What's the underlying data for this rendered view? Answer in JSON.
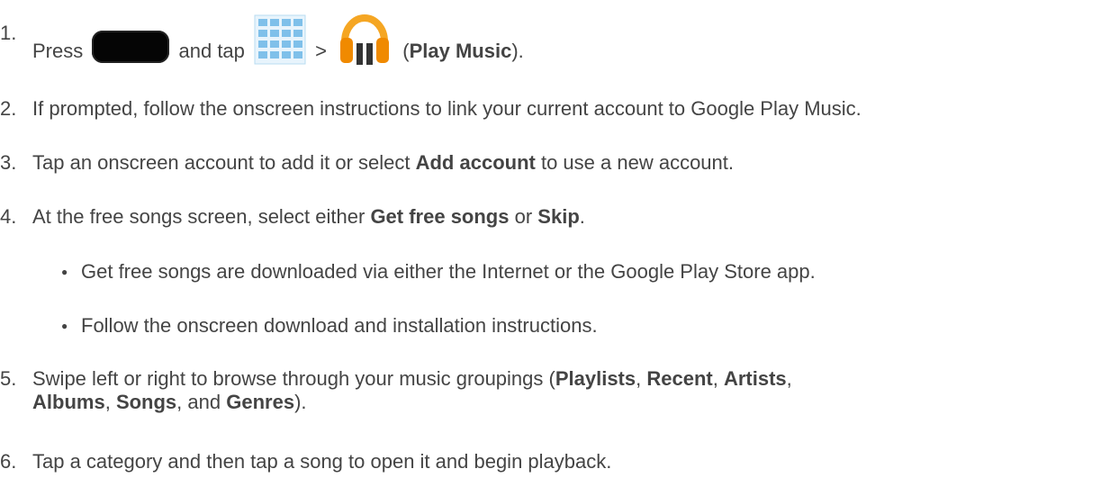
{
  "steps": [
    {
      "number": "1.",
      "parts": {
        "a": "Press",
        "b": "and tap",
        "c": ">",
        "d": "(",
        "e": "Play Music",
        "f": ")."
      }
    },
    {
      "number": "2.",
      "text": "If prompted, follow the onscreen instructions to link your current account to Google Play Music."
    },
    {
      "number": "3.",
      "parts": {
        "a": "Tap an onscreen account to add it or select",
        "b": "Add account",
        "c": "to use a new account."
      }
    },
    {
      "number": "4.",
      "parts": {
        "a": "At the free songs screen, select either",
        "b": "Get free songs",
        "c": "or",
        "d": "Skip",
        "e": "."
      }
    },
    {
      "number": "5.",
      "parts": {
        "a": "Swipe left or right to browse through your music groupings (",
        "b": "Playlists",
        "c": ",",
        "d": "Recent",
        "e": ",",
        "f": "Artists",
        "g": ",",
        "h": "Albums",
        "i": ",",
        "j": "Songs",
        "k": ", and",
        "l": "Genres",
        "m": ")."
      }
    },
    {
      "number": "6.",
      "text": "Tap a category and then tap a song to open it and begin playback."
    }
  ],
  "sub_bullets": [
    {
      "bullet": "●",
      "text": "Get free songs are downloaded via either the Internet or the Google Play Store app."
    },
    {
      "bullet": "●",
      "text": "Follow the onscreen download and installation instructions."
    }
  ],
  "icons": {
    "home": "home-key-icon",
    "apps": "apps-grid-icon",
    "music": "play-music-headphones-icon"
  },
  "colors": {
    "text": "#444444",
    "apps_blue": "#7fc0ea",
    "music_orange": "#f5a623"
  }
}
